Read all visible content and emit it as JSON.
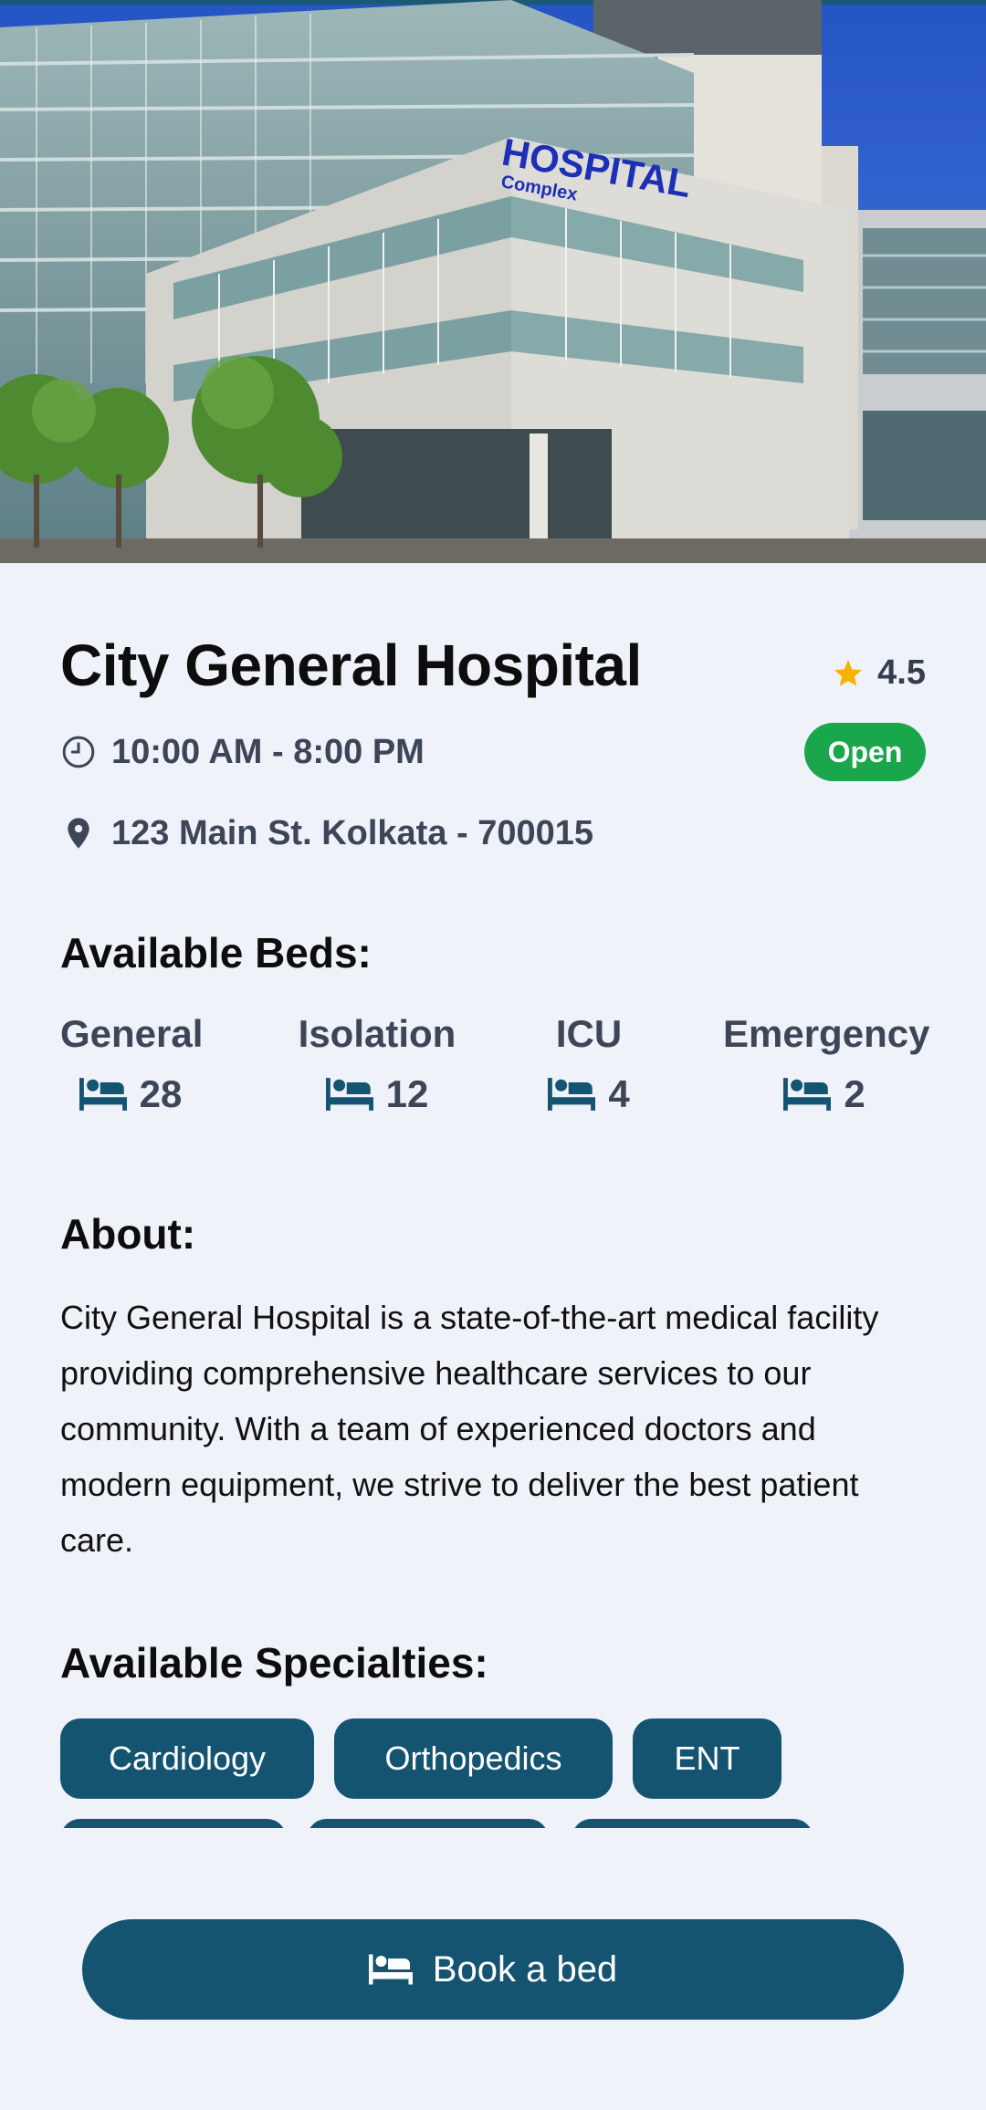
{
  "hospital": {
    "name": "City General Hospital",
    "rating": "4.5",
    "hours": "10:00 AM - 8:00 PM",
    "status": "Open",
    "address": "123 Main St. Kolkata - 700015"
  },
  "hero": {
    "sign_main": "HOSPITAL",
    "sign_sub": "Complex"
  },
  "beds": {
    "heading": "Available Beds:",
    "items": [
      {
        "label": "General",
        "count": "28"
      },
      {
        "label": "Isolation",
        "count": "12"
      },
      {
        "label": "ICU",
        "count": "4"
      },
      {
        "label": "Emergency",
        "count": "2"
      }
    ]
  },
  "about": {
    "heading": "About:",
    "text": "City General Hospital is a state-of-the-art medical facility providing comprehensive healthcare services to our community. With a team of experienced doctors and modern equipment, we strive to deliver the best patient care."
  },
  "specialties": {
    "heading": "Available Specialties:",
    "items": [
      "Cardiology",
      "Orthopedics",
      "ENT"
    ]
  },
  "actions": {
    "book_label": "Book a bed"
  },
  "colors": {
    "primary": "#145471",
    "open": "#1aa64b",
    "star": "#f5b400",
    "background": "#eff2f8"
  },
  "icons": {
    "rating": "star-icon",
    "hours": "clock-icon",
    "address": "location-pin-icon",
    "bed": "bed-icon"
  }
}
